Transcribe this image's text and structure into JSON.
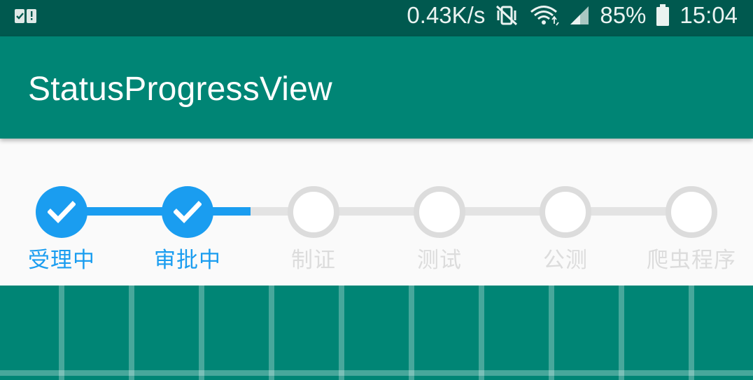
{
  "status_bar": {
    "network_speed": "0.43K/s",
    "battery": "85%",
    "time": "15:04",
    "icons": [
      "notification-icon",
      "vibrate-icon",
      "wifi-icon",
      "signal-icon",
      "battery-icon"
    ]
  },
  "app_bar": {
    "title": "StatusProgressView"
  },
  "progress": {
    "current_step": 2,
    "steps": [
      {
        "label": "受理中",
        "done": true
      },
      {
        "label": "审批中",
        "done": true
      },
      {
        "label": "制证",
        "done": false
      },
      {
        "label": "测试",
        "done": false
      },
      {
        "label": "公测",
        "done": false
      },
      {
        "label": "爬虫程序",
        "done": false
      }
    ]
  },
  "colors": {
    "status_bar": "#00594f",
    "app_bar": "#008575",
    "accent": "#1a9df0",
    "inactive": "#dcdcdc",
    "background": "#fafafa"
  }
}
